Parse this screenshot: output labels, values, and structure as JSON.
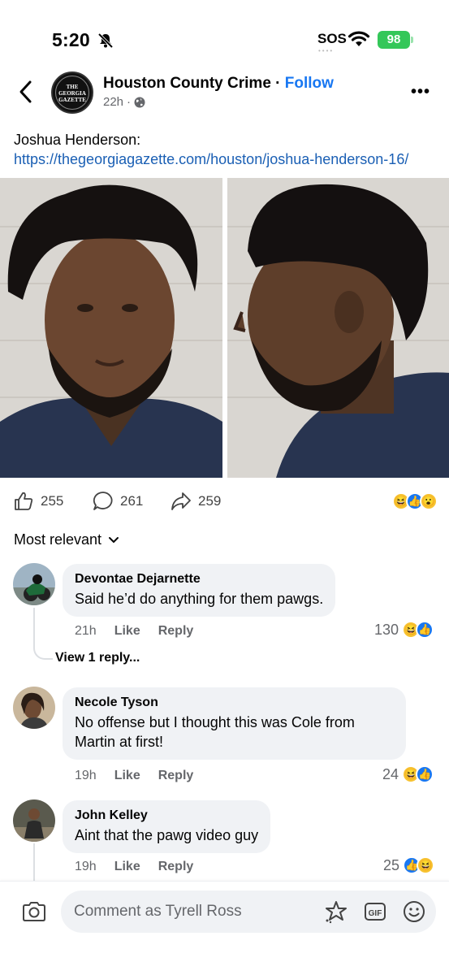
{
  "status_bar": {
    "time": "5:20",
    "sos": "SOS",
    "battery": "98"
  },
  "post": {
    "page_name": "Houston County Crime",
    "separator": "·",
    "follow": "Follow",
    "time": "22h",
    "meta_separator": "·",
    "text_prefix": "Joshua Henderson: ",
    "link_text": "https://thegeorgiagazette.com/houston/joshua-henderson-16/",
    "avatar_logo": "THE GEORGIA GAZETTE"
  },
  "actions": {
    "likes": "255",
    "comments": "261",
    "shares": "259"
  },
  "sort_label": "Most relevant",
  "comments": [
    {
      "name": "Devontae Dejarnette",
      "text": "Said he’d do anything for them pawgs.",
      "time": "21h",
      "like_label": "Like",
      "reply_label": "Reply",
      "reaction_count": "130",
      "view_replies": "View 1 reply..."
    },
    {
      "name": "Necole Tyson",
      "text": "No offense but I thought this was Cole from Martin at first!",
      "time": "19h",
      "like_label": "Like",
      "reply_label": "Reply",
      "reaction_count": "24"
    },
    {
      "name": "John Kelley",
      "text": "Aint that the pawg video guy",
      "time": "19h",
      "like_label": "Like",
      "reply_label": "Reply",
      "reaction_count": "25"
    }
  ],
  "composer": {
    "placeholder": "Comment as Tyrell Ross"
  },
  "colors": {
    "link": "#1877f2",
    "bubble": "#f0f2f5",
    "battery": "#34c759"
  }
}
